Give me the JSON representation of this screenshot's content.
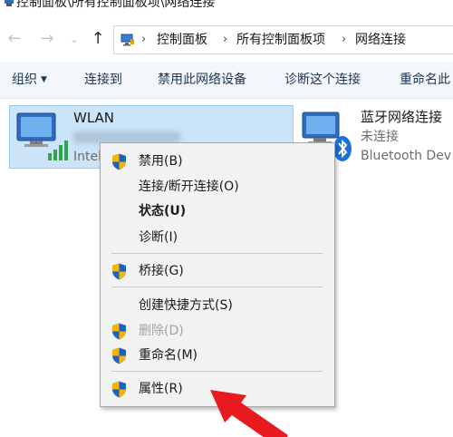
{
  "window": {
    "title": "控制面板\\所有控制面板项\\网络连接"
  },
  "nav": {
    "back_glyph": "←",
    "forward_glyph": "→",
    "recent_glyph": "⌄",
    "up_glyph": "↑",
    "breadcrumbs": [
      "控制面板",
      "所有控制面板项",
      "网络连接"
    ],
    "separator": "›"
  },
  "commandbar": {
    "items": [
      "组织",
      "连接到",
      "禁用此网络设备",
      "诊断这个连接",
      "重命名此"
    ]
  },
  "connections": [
    {
      "name": "WLAN",
      "device": "Intel",
      "icon": "wifi-adapter-icon",
      "selected": true
    },
    {
      "name": "蓝牙网络连接",
      "status": "未连接",
      "device": "Bluetooth Dev",
      "icon": "bluetooth-adapter-icon"
    }
  ],
  "context_menu": {
    "items": [
      {
        "label": "禁用(B)",
        "shield": true
      },
      {
        "label": "连接/断开连接(O)",
        "shield": false
      },
      {
        "label": "状态(U)",
        "shield": false,
        "bold": true
      },
      {
        "label": "诊断(I)",
        "shield": false
      },
      {
        "label": "桥接(G)",
        "shield": true
      },
      {
        "label": "创建快捷方式(S)",
        "shield": false
      },
      {
        "label": "删除(D)",
        "shield": true,
        "disabled": true
      },
      {
        "label": "重命名(M)",
        "shield": true
      },
      {
        "label": "属性(R)",
        "shield": true
      }
    ]
  },
  "colors": {
    "selection_fill": "#cce4f7",
    "menu_background": "#f2f2f2",
    "arrow": "#e8191f",
    "shield_blue": "#1f5fbf",
    "shield_gold": "#f2b705"
  }
}
